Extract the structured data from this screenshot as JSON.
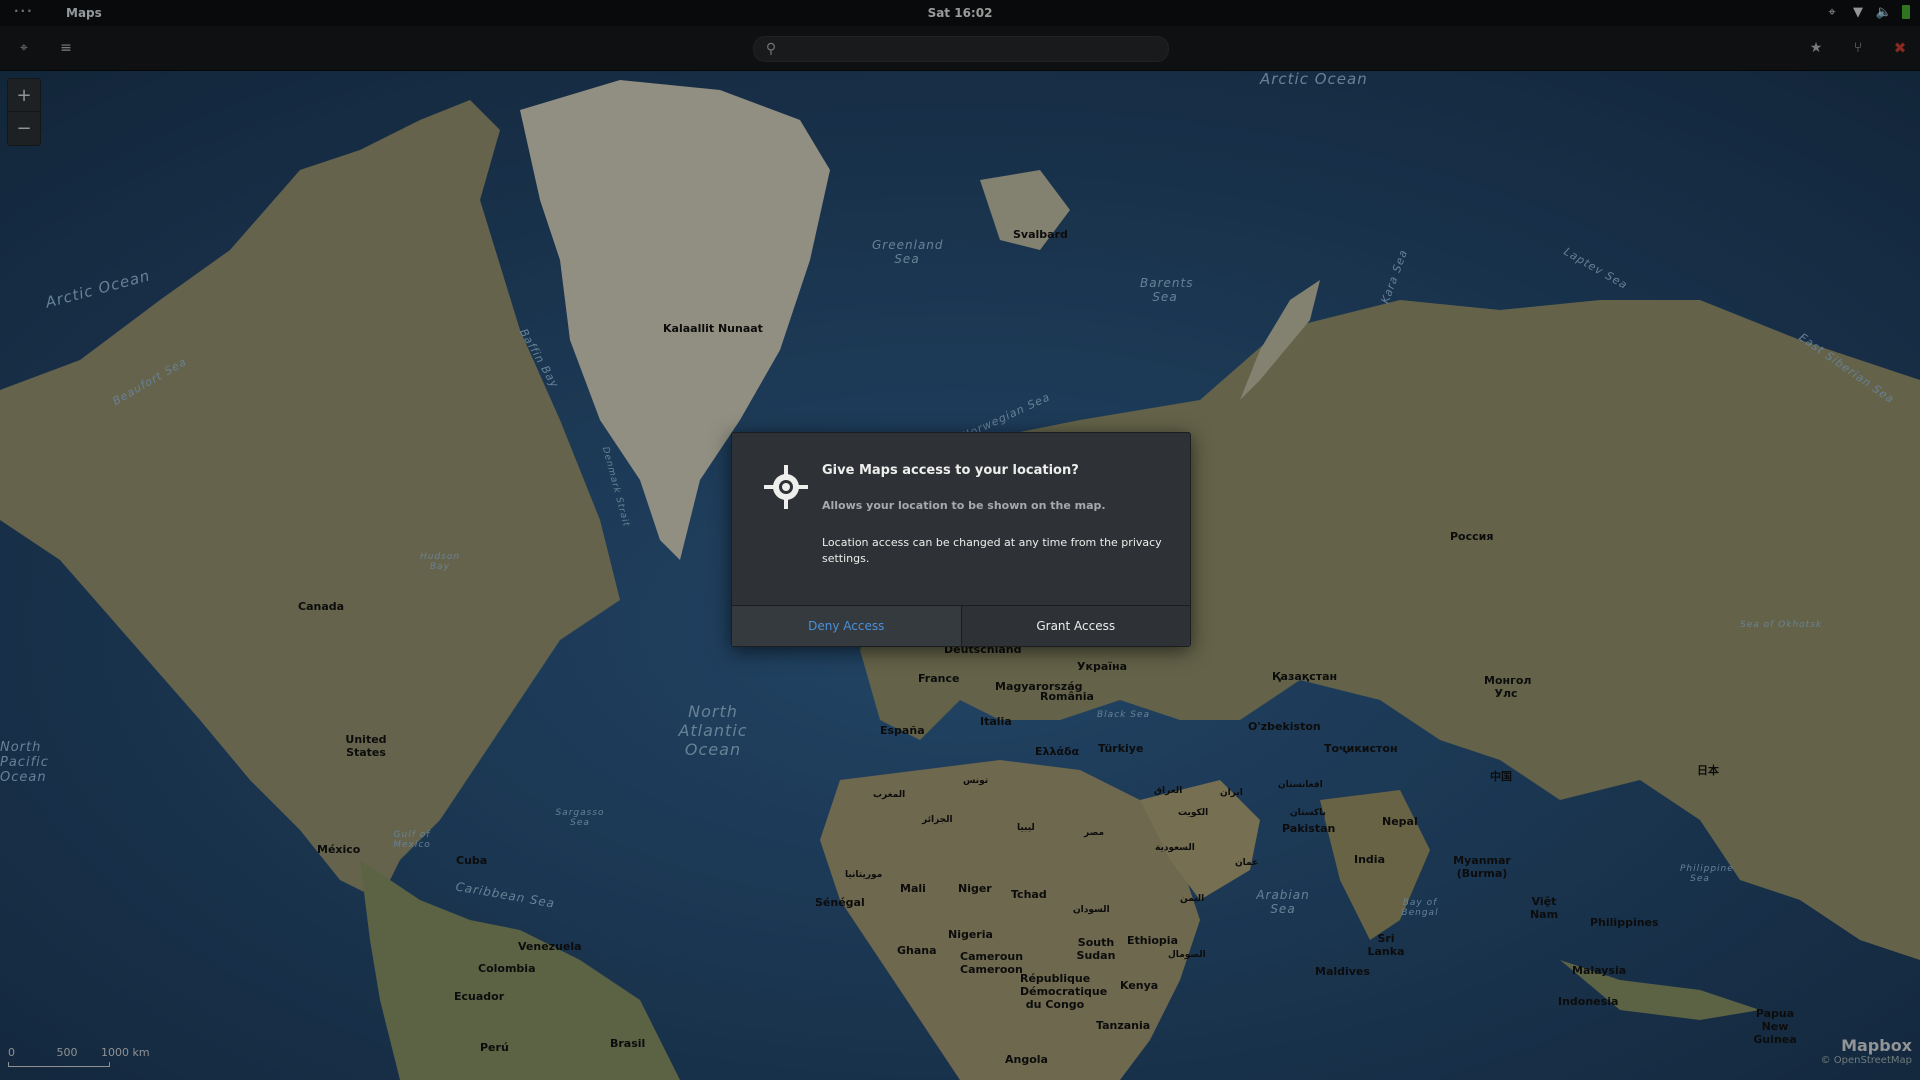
{
  "topbar": {
    "activities_dots": "···",
    "app_name": "Maps",
    "clock": "Sat 16:02",
    "status_icons": [
      "location-icon",
      "wifi-icon",
      "volume-icon",
      "battery-icon"
    ]
  },
  "headerbar": {
    "left_buttons": [
      "location-icon",
      "layers-icon"
    ],
    "search": {
      "value": "",
      "placeholder": ""
    },
    "right_buttons": [
      "star-icon",
      "route-icon",
      "close-icon"
    ]
  },
  "zoom": {
    "in": "+",
    "out": "−"
  },
  "map": {
    "oceans": [
      "Arctic Ocean",
      "Arctic Ocean",
      "Greenland Sea",
      "Barents Sea",
      "Kara Sea",
      "Laptev Sea",
      "Norwegian Sea",
      "Hudson Bay",
      "Baffin Bay",
      "Beaufort Sea",
      "East Siberian Sea",
      "Denmark Strait",
      "North Atlantic Ocean",
      "Sargasso Sea",
      "Gulf of Mexico",
      "Caribbean Sea",
      "Arabian Sea",
      "Bay of Bengal",
      "Sea of Okhotsk",
      "Black Sea",
      "Philippine Sea",
      "North Pacific Ocean"
    ],
    "places": [
      "Kalaallit Nunaat",
      "Svalbard",
      "Canada",
      "United States",
      "México",
      "Cuba",
      "Россия",
      "Deutschland",
      "France",
      "España",
      "Italia",
      "Україна",
      "Magyarország",
      "România",
      "Ελλάδα",
      "Türkiye",
      "Қазақстан",
      "O'zbekiston",
      "Тоҷикистон",
      "Монгол Улс",
      "中国",
      "日本",
      "Nepal",
      "Pakistan",
      "India",
      "Myanmar (Burma)",
      "Việt Nam",
      "Philippines",
      "Malaysia",
      "Indonesia",
      "Papua New Guinea",
      "Sri Lanka",
      "Maldives",
      "Mali",
      "Niger",
      "Tchad",
      "Sénégal",
      "Nigeria",
      "Ghana",
      "Cameroun Cameroon",
      "République Démocratique du Congo",
      "Kenya",
      "Tanzania",
      "Angola",
      "South Sudan",
      "Ethiopia",
      "Venezuela",
      "Colombia",
      "Ecuador",
      "Perú",
      "Brasil",
      "الجزائر",
      "ليبيا",
      "مصر",
      "السعودية",
      "العراق",
      "ایران",
      "المغرب",
      "موريتانيا",
      "السودان",
      "اليمن",
      "تونس",
      "الكويت",
      "عمان",
      "افغانستان",
      "پاکستان",
      "الصومال"
    ],
    "scale": {
      "labels": [
        "0",
        "500",
        "1000 km"
      ]
    },
    "attribution": {
      "brand": "Mapbox",
      "osm": "© OpenStreetMap"
    }
  },
  "dialog": {
    "title": "Give Maps access to your location?",
    "subtitle": "Allows your location to be shown on the map.",
    "body": "Location access can be changed at any time from the privacy settings.",
    "deny_label": "Deny Access",
    "grant_label": "Grant Access"
  }
}
